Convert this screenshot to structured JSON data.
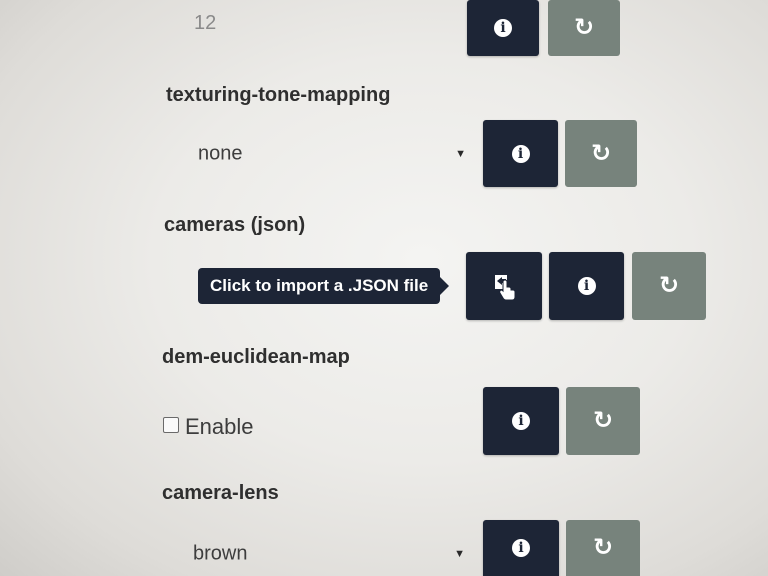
{
  "fields": [
    {
      "value": "12"
    },
    {
      "label": "texturing-tone-mapping",
      "value": "none"
    },
    {
      "label": "cameras (json)",
      "tooltip": "Click to import a .JSON file"
    },
    {
      "label": "dem-euclidean-map",
      "checkbox_label": "Enable"
    },
    {
      "label": "camera-lens",
      "value": "brown"
    }
  ],
  "icons": {
    "info": "i",
    "refresh": "↻",
    "import": "import-hand-icon",
    "caret": "▼"
  },
  "colors": {
    "dark_button": "#1d2536",
    "grey_button": "#77837c",
    "background": "#ecebe8"
  }
}
